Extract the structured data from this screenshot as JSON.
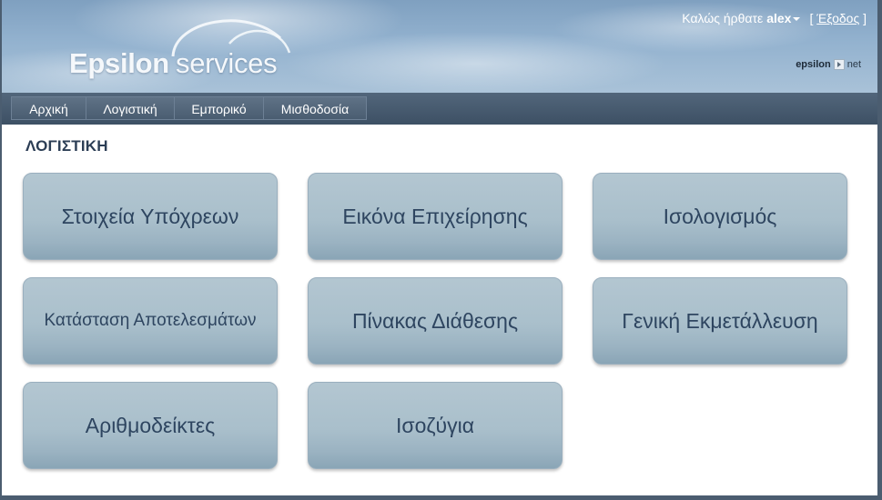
{
  "header": {
    "logo_word_1": "Epsilon",
    "logo_word_2": "services",
    "welcome_text": "Καλώς ήρθατε",
    "username": "alex",
    "logout_open": "[",
    "logout_label": "Έξοδος",
    "logout_close": "]",
    "brand_part_1": "epsilon",
    "brand_part_2": "net"
  },
  "nav": {
    "tabs": [
      {
        "label": "Αρχική"
      },
      {
        "label": "Λογιστική"
      },
      {
        "label": "Εμπορικό"
      },
      {
        "label": "Μισθοδοσία"
      }
    ]
  },
  "main": {
    "section_title": "ΛΟΓΙΣΤΙΚΗ",
    "tiles": [
      {
        "label": "Στοιχεία Υπόχρεων"
      },
      {
        "label": "Εικόνα Επιχείρησης"
      },
      {
        "label": "Ισολογισμός"
      },
      {
        "label": "Κατάσταση Αποτελεσμάτων"
      },
      {
        "label": "Πίνακας Διάθεσης"
      },
      {
        "label": "Γενική Εκμετάλλευση"
      },
      {
        "label": "Αριθμοδείκτες"
      },
      {
        "label": "Ισοζύγια"
      }
    ]
  },
  "colors": {
    "nav_background": "#3d5064",
    "tile_background": "#a9bfcb",
    "tile_text": "#2e4560",
    "section_title": "#2c3e55"
  },
  "icons": {
    "logo_arcs": "cloud-arcs-logo",
    "user_menu_caret": "caret-down-icon",
    "brand_separator": "play-arrow-icon"
  }
}
